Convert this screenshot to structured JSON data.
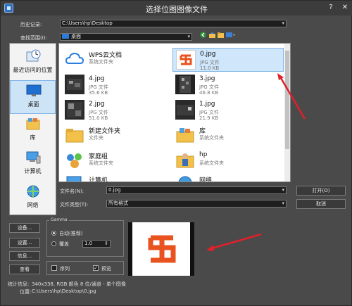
{
  "window": {
    "title": "选择位图图像文件"
  },
  "history": {
    "label": "历史记录:",
    "value": "C:\\Users\\hp\\Desktop"
  },
  "lookin": {
    "label": "查找范围(I):",
    "value": "桌面"
  },
  "places": [
    {
      "label": "最近访问的位置",
      "icon": "recent-places-icon"
    },
    {
      "label": "桌面",
      "icon": "desktop-icon"
    },
    {
      "label": "库",
      "icon": "library-icon"
    },
    {
      "label": "计算机",
      "icon": "computer-icon"
    },
    {
      "label": "网络",
      "icon": "network-icon"
    }
  ],
  "files": [
    {
      "name": "WPS云文档",
      "type": "系统文件夹",
      "size": "",
      "icon": "cloud-icon"
    },
    {
      "name": "0.jpg",
      "type": "JPG 文件",
      "size": "11.0 KB",
      "icon": "logo-thumbnail"
    },
    {
      "name": "4.jpg",
      "type": "JPG 文件",
      "size": "35.6 KB",
      "icon": "image-thumbnail"
    },
    {
      "name": "3.jpg",
      "type": "JPG 文件",
      "size": "46.8 KB",
      "icon": "image-thumbnail"
    },
    {
      "name": "2.jpg",
      "type": "JPG 文件",
      "size": "51.0 KB",
      "icon": "image-thumbnail"
    },
    {
      "name": "1.jpg",
      "type": "JPG 文件",
      "size": "21.9 KB",
      "icon": "image-thumbnail"
    },
    {
      "name": "新建文件夹",
      "type": "文件夹",
      "size": "",
      "icon": "folder-icon"
    },
    {
      "name": "库",
      "type": "系统文件夹",
      "size": "",
      "icon": "library-folder-icon"
    },
    {
      "name": "家庭组",
      "type": "系统文件夹",
      "size": "",
      "icon": "homegroup-icon"
    },
    {
      "name": "hp",
      "type": "系统文件夹",
      "size": "",
      "icon": "user-folder-icon"
    },
    {
      "name": "计算机",
      "type": "",
      "size": "",
      "icon": "computer-icon"
    },
    {
      "name": "网络",
      "type": "",
      "size": "",
      "icon": "network-icon"
    }
  ],
  "filename": {
    "label": "文件名(N):",
    "value": "0.jpg"
  },
  "filetype": {
    "label": "文件类型(T):",
    "value": "所有格式"
  },
  "buttons": {
    "open": "打开(O)",
    "cancel": "取消",
    "setup": "设备...",
    "settings": "设置...",
    "info": "信息...",
    "view": "查看"
  },
  "gamma": {
    "title": "Gamma",
    "auto_label": "自动(推荐)",
    "override_label": "覆盖",
    "override_value": "1.0"
  },
  "options": {
    "sequence_label": "序列",
    "preview_label": "预览",
    "preview_checked": true
  },
  "status": {
    "stats_label": "统计信息:",
    "stats_value": "340x338, RGB 颜色 8 位/通道 - 单个图像",
    "location_label": "位置:",
    "location_value": "C:\\Users\\hp\\Desktop\\0.jpg"
  },
  "colors": {
    "accent": "#e8531f",
    "arrow": "#e0202a",
    "selection": "#cfe6fb"
  }
}
